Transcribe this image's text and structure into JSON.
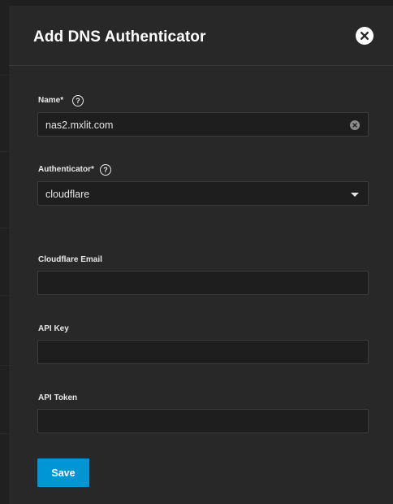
{
  "dialog": {
    "title": "Add DNS Authenticator"
  },
  "form": {
    "name": {
      "label": "Name",
      "required_mark": "*",
      "value": "nas2.mxlit.com"
    },
    "authenticator": {
      "label": "Authenticator",
      "required_mark": "*",
      "selected": "cloudflare"
    },
    "cloudflare_email": {
      "label": "Cloudflare Email",
      "value": ""
    },
    "api_key": {
      "label": "API Key",
      "value": ""
    },
    "api_token": {
      "label": "API Token",
      "value": ""
    }
  },
  "actions": {
    "save_label": "Save"
  },
  "icons": {
    "close": "close-icon",
    "help": "help-icon",
    "clear": "clear-icon",
    "dropdown": "chevron-down-icon"
  },
  "colors": {
    "panel_bg": "#282828",
    "field_bg": "#1e1e1e",
    "accent": "#0095d5",
    "text": "#ffffff"
  }
}
